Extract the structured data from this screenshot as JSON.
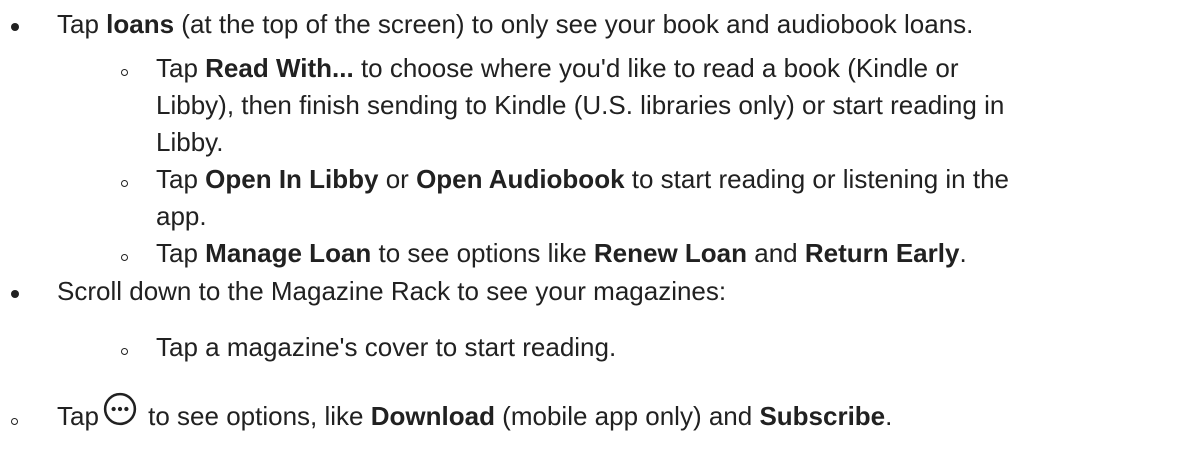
{
  "items": [
    {
      "segments": [
        {
          "t": "Tap "
        },
        {
          "t": "loans",
          "b": true
        },
        {
          "t": " (at the top of the screen) to only see your book and audiobook loans."
        }
      ]
    },
    {
      "sub_items": [
        {
          "lines": [
            [
              {
                "t": "Tap "
              },
              {
                "t": "Read With...",
                "b": true
              },
              {
                "t": " to choose where you'd like to read a book (Kindle or"
              }
            ],
            [
              {
                "t": "Libby), then finish sending to Kindle (U.S. libraries only) or start reading in"
              }
            ],
            [
              {
                "t": "Libby."
              }
            ]
          ]
        },
        {
          "lines": [
            [
              {
                "t": "Tap "
              },
              {
                "t": "Open In Libby",
                "b": true
              },
              {
                "t": " or "
              },
              {
                "t": "Open Audiobook",
                "b": true
              },
              {
                "t": " to start reading or listening in the"
              }
            ],
            [
              {
                "t": "app."
              }
            ]
          ]
        },
        {
          "lines": [
            [
              {
                "t": "Tap "
              },
              {
                "t": "Manage Loan",
                "b": true
              },
              {
                "t": " to see options like "
              },
              {
                "t": "Renew Loan",
                "b": true
              },
              {
                "t": " and "
              },
              {
                "t": "Return Early",
                "b": true
              },
              {
                "t": "."
              }
            ]
          ]
        }
      ]
    },
    {
      "segments": [
        {
          "t": "Scroll down to the Magazine Rack to see your magazines:"
        }
      ]
    },
    {
      "sub": [
        {
          "t": "Tap a magazine's cover to start reading."
        }
      ]
    },
    {
      "last": {
        "before": "Tap",
        "icon": "more-options-icon",
        "after_segments": [
          {
            "t": " to see options, like "
          },
          {
            "t": "Download",
            "b": true
          },
          {
            "t": " (mobile app only) and "
          },
          {
            "t": "Subscribe",
            "b": true
          },
          {
            "t": "."
          }
        ]
      }
    }
  ]
}
